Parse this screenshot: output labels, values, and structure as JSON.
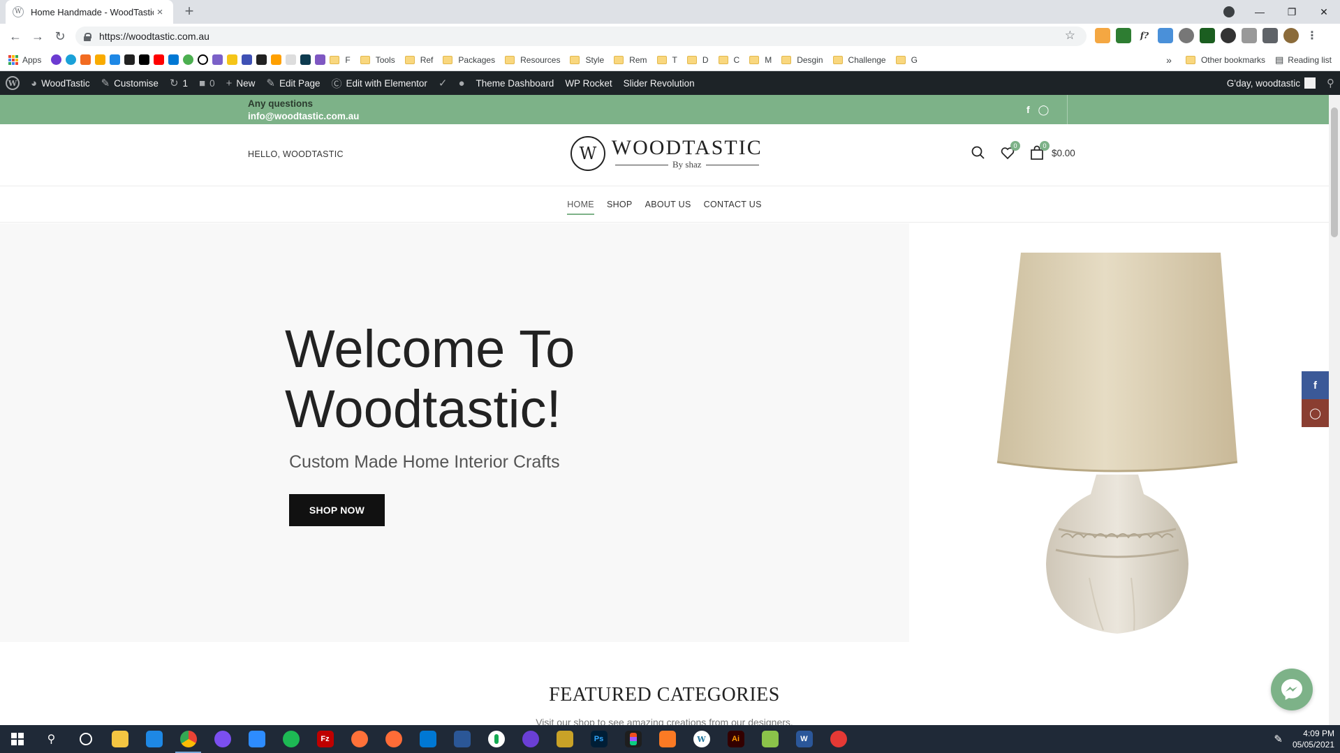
{
  "browser": {
    "tab_title": "Home Handmade - WoodTastic",
    "tab_close": "×",
    "new_tab": "+",
    "url": "https://woodtastic.com.au",
    "bookmarks": [
      "Apps",
      "F",
      "Tools",
      "Ref",
      "Packages",
      "Resources",
      "Style",
      "Rem",
      "T",
      "D",
      "C",
      "M",
      "Desgin",
      "Challenge",
      "G"
    ],
    "bookmarks_overflow": "»",
    "other_bookmarks": "Other bookmarks",
    "reading_list": "Reading list"
  },
  "wp_admin_bar": {
    "site_name": "WoodTastic",
    "customise": "Customise",
    "updates_count": "1",
    "comments_count": "0",
    "new": "New",
    "edit_page": "Edit Page",
    "edit_elementor": "Edit with Elementor",
    "theme_dashboard": "Theme Dashboard",
    "wp_rocket": "WP Rocket",
    "slider_revolution": "Slider Revolution",
    "greeting": "G'day, woodtastic"
  },
  "topbar": {
    "question": "Any questions",
    "email": "info@woodtastic.com.au"
  },
  "header": {
    "hello": "HELLO, WOODTASTIC",
    "logo_letter": "W",
    "logo_name": "WOODTASTIC",
    "logo_sub": "By shaz",
    "wishlist_count": "0",
    "cart_count": "0",
    "cart_total": "$0.00"
  },
  "nav": {
    "items": [
      "HOME",
      "SHOP",
      "ABOUT US",
      "CONTACT US"
    ],
    "active": "HOME"
  },
  "hero": {
    "title_line1": "Welcome To",
    "title_line2": "Woodtastic!",
    "subtitle": "Custom Made Home Interior Crafts",
    "cta": "SHOP NOW"
  },
  "featured": {
    "title": "FEATURED CATEGORIES",
    "subtitle": "Visit our shop to see amazing creations from our designers."
  },
  "taskbar": {
    "time": "4:09 PM",
    "date": "05/05/2021"
  },
  "colors": {
    "accent_green": "#7db288",
    "wp_bar": "#1d2327",
    "facebook": "#3b5998",
    "instagram": "#8a3e31",
    "button": "#111111"
  }
}
